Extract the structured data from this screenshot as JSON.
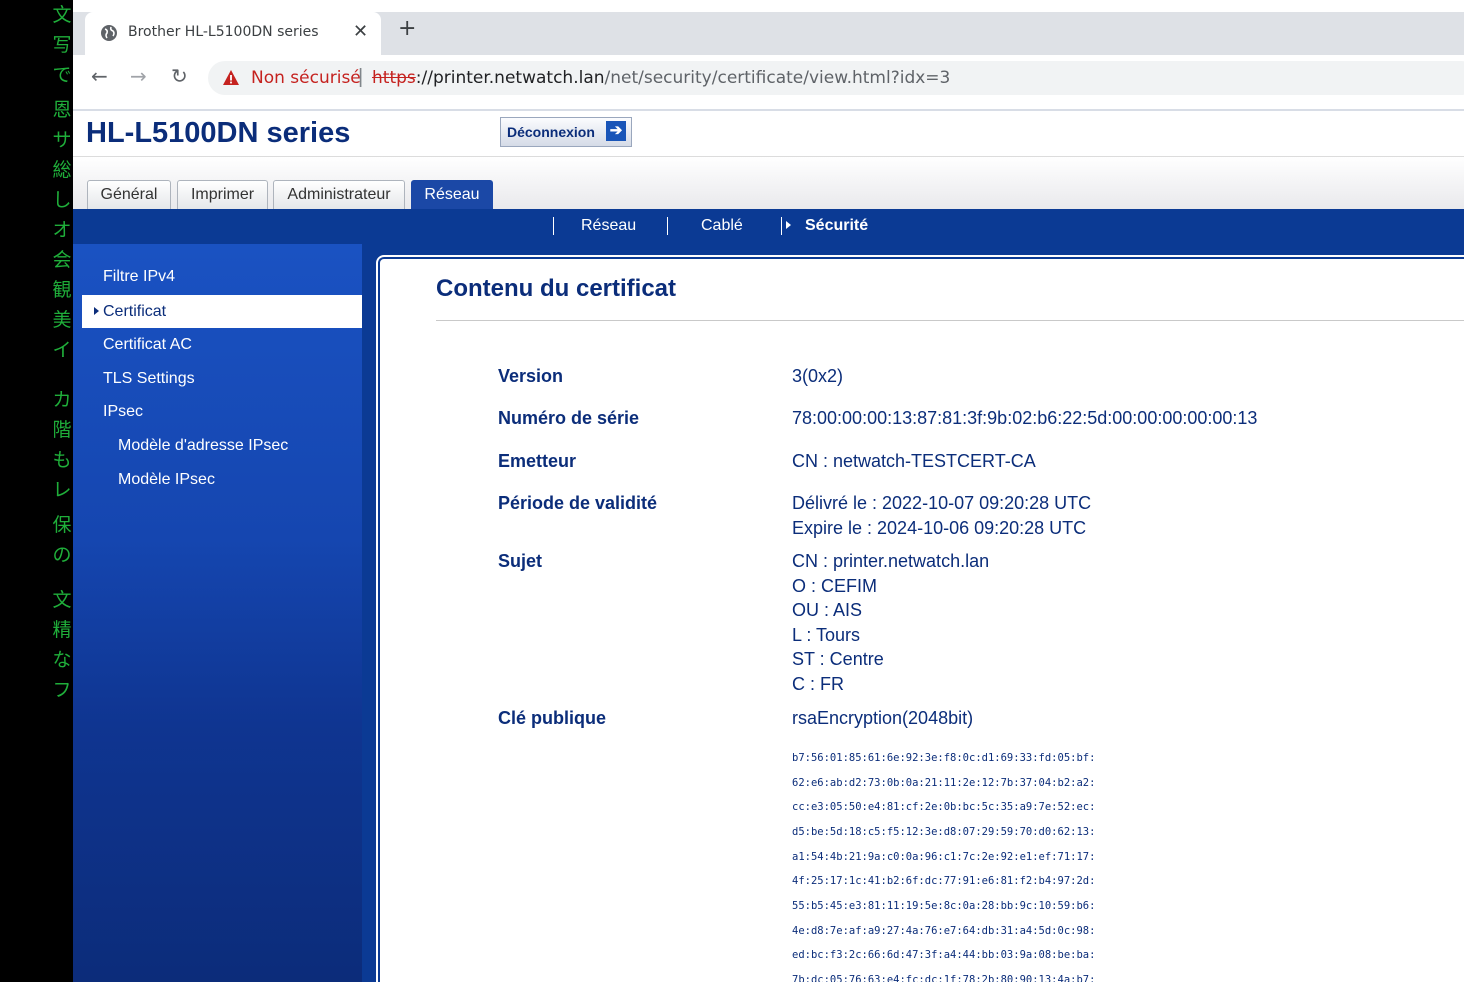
{
  "browser": {
    "tab_title": "Brother HL-L5100DN series",
    "tab_close": "✕",
    "new_tab": "+",
    "back": "←",
    "forward": "→",
    "reload": "↻",
    "security_status": "Non sécurisé",
    "url_scheme": "https",
    "url_host": "://printer.netwatch.lan",
    "url_path": "/net/security/certificate/view.html?idx=3"
  },
  "header": {
    "model": "HL-L5100DN series",
    "logout_label": "Déconnexion",
    "logout_icon": "arrow-right-icon"
  },
  "tabs": [
    "Général",
    "Imprimer",
    "Administrateur",
    "Réseau"
  ],
  "active_tab": "Réseau",
  "subnav": [
    "Réseau",
    "Cablé",
    "Sécurité"
  ],
  "active_subnav": "Sécurité",
  "sidebar": {
    "items": [
      {
        "label": "Filtre IPv4"
      },
      {
        "label": "Certificat"
      },
      {
        "label": "Certificat AC"
      },
      {
        "label": "TLS Settings"
      },
      {
        "label": "IPsec"
      },
      {
        "label": "Modèle d'adresse IPsec"
      },
      {
        "label": "Modèle IPsec"
      }
    ],
    "active": "Certificat"
  },
  "content": {
    "title": "Contenu du certificat",
    "fields": [
      {
        "label": "Version",
        "lines": [
          "3(0x2)"
        ]
      },
      {
        "label": "Numéro de série",
        "lines": [
          "78:00:00:00:13:87:81:3f:9b:02:b6:22:5d:00:00:00:00:00:13"
        ]
      },
      {
        "label": "Emetteur",
        "lines": [
          "CN : netwatch-TESTCERT-CA"
        ]
      },
      {
        "label": "Période de validité",
        "lines": [
          "Délivré le : 2022-10-07 09:20:28 UTC",
          "Expire le : 2024-10-06 09:20:28 UTC"
        ]
      },
      {
        "label": "Sujet",
        "lines": [
          "CN : printer.netwatch.lan",
          "O : CEFIM",
          "OU : AIS",
          "L : Tours",
          "ST : Centre",
          "C : FR"
        ]
      },
      {
        "label": "Clé publique",
        "lines": [
          "rsaEncryption(2048bit)"
        ]
      }
    ],
    "public_key_hex": [
      "b7:56:01:85:61:6e:92:3e:f8:0c:d1:69:33:fd:05:bf:",
      "62:e6:ab:d2:73:0b:0a:21:11:2e:12:7b:37:04:b2:a2:",
      "cc:e3:05:50:e4:81:cf:2e:0b:bc:5c:35:a9:7e:52:ec:",
      "d5:be:5d:18:c5:f5:12:3e:d8:07:29:59:70:d0:62:13:",
      "a1:54:4b:21:9a:c0:0a:96:c1:7c:2e:92:e1:ef:71:17:",
      "4f:25:17:1c:41:b2:6f:dc:77:91:e6:81:f2:b4:97:2d:",
      "55:b5:45:e3:81:11:19:5e:8c:0a:28:bb:9c:10:59:b6:",
      "4e:d8:7e:af:a9:27:4a:76:e7:64:db:31:a4:5d:0c:98:",
      "ed:bc:f3:2c:66:6d:47:3f:a4:44:bb:03:9a:08:be:ba:",
      "7b:dc:05:76:63:e4:fc:dc:1f:78:2b:80:90:13:4a:b7:"
    ]
  },
  "terminal_columns": [
    "文写で",
    "恩サ総しオ会観美イ",
    "カ階もレ",
    "保の",
    "文精なフ"
  ]
}
